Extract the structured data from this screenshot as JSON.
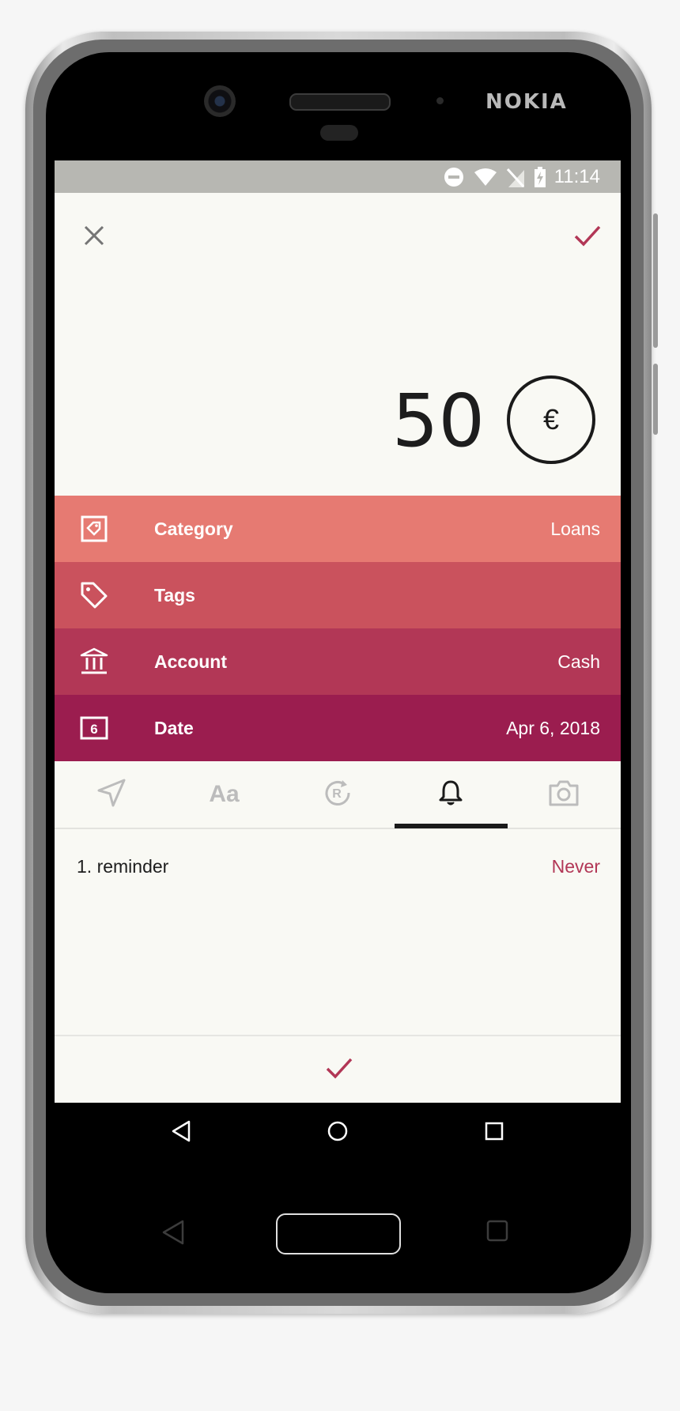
{
  "device": {
    "brand": "NOKIA"
  },
  "statusbar": {
    "time": "11:14",
    "icons": [
      "do-not-disturb-icon",
      "wifi-icon",
      "no-sim-icon",
      "battery-charging-icon"
    ]
  },
  "header": {
    "close_icon": "close-icon",
    "confirm_icon": "check-icon"
  },
  "amount": {
    "value": "50",
    "currency_symbol": "€"
  },
  "fields": [
    {
      "icon": "category-icon",
      "label": "Category",
      "value": "Loans",
      "color": "#e67a72"
    },
    {
      "icon": "tag-icon",
      "label": "Tags",
      "value": "",
      "color": "#ca525d"
    },
    {
      "icon": "bank-icon",
      "label": "Account",
      "value": "Cash",
      "color": "#b23756"
    },
    {
      "icon": "calendar-icon",
      "label": "Date",
      "value": "Apr 6, 2018",
      "calendar_day": "6",
      "color": "#9b1d4f"
    }
  ],
  "tabs": [
    {
      "icon": "location-icon",
      "active": false
    },
    {
      "icon": "text-note-icon",
      "label": "Aa",
      "active": false
    },
    {
      "icon": "recurring-icon",
      "active": false
    },
    {
      "icon": "bell-icon",
      "active": true
    },
    {
      "icon": "camera-icon",
      "active": false
    }
  ],
  "reminders": [
    {
      "label": "1. reminder",
      "value": "Never"
    }
  ],
  "colors": {
    "accent": "#b23756",
    "background": "#f9f9f4",
    "statusbar": "#b7b7b2"
  },
  "navbar": {
    "icons": [
      "back-icon",
      "home-icon",
      "recents-icon"
    ]
  }
}
